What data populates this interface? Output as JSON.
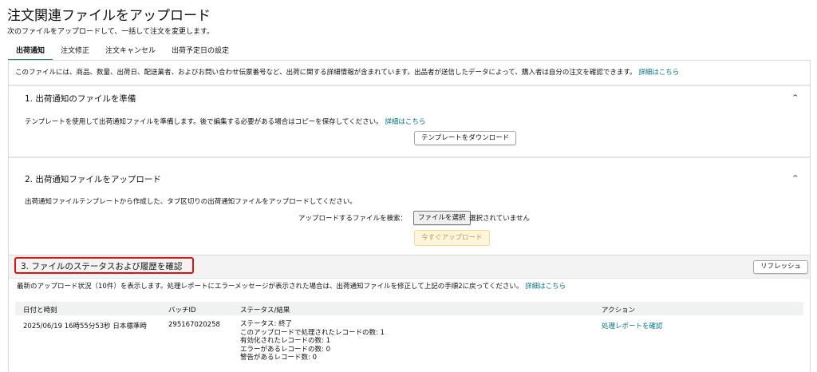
{
  "header": {
    "title": "注文関連ファイルをアップロード",
    "subtitle": "次のファイルをアップロードして、一括して注文を変更します。"
  },
  "tabs": [
    {
      "label": "出荷通知",
      "active": true
    },
    {
      "label": "注文修正",
      "active": false
    },
    {
      "label": "注文キャンセル",
      "active": false
    },
    {
      "label": "出荷予定日の設定",
      "active": false
    }
  ],
  "intro": {
    "text": "このファイルには、商品、数量、出荷日、配送業者、およびお問い合わせ伝票番号など、出荷に関する詳細情報が含まれています。出品者が送信したデータによって、購入者は自分の注文を確認できます。",
    "link": "詳細はこちら"
  },
  "section1": {
    "title": "1. 出荷通知のファイルを準備",
    "text": "テンプレートを使用して出荷通知ファイルを準備します。後で編集する必要がある場合はコピーを保存してください。",
    "link": "詳細はこちら",
    "button": "テンプレートをダウンロード"
  },
  "section2": {
    "title": "2. 出荷通知ファイルをアップロード",
    "text": "出荷通知ファイルテンプレートから作成した、タブ区切りの出荷通知ファイルをアップロードしてください。",
    "file_label": "アップロードするファイルを検索：",
    "file_button": "ファイルを選択",
    "file_status": "選択されていません",
    "upload_button": "今すぐアップロード"
  },
  "section3": {
    "title": "3. ファイルのステータスおよび履歴を確認",
    "refresh_button": "リフレッシュ",
    "text": "最新のアップロード状況（10件）を表示します。処理レポートにエラーメッセージが表示された場合は、出荷通知ファイルを修正して上記の手順2に戻ってください。",
    "link": "詳細はこちら"
  },
  "table": {
    "headers": [
      "日付と時刻",
      "バッチID",
      "ステータス/結果",
      "アクション"
    ],
    "rows": [
      {
        "datetime": "2025/06/19 16時55分53秒 日本標準時",
        "batch_id": "295167020258",
        "status": [
          "ステータス: 終了",
          "このアップロードで処理されたレコードの数: 1",
          "有効化されたレコードの数: 1",
          "エラーがあるレコードの数: 0",
          "警告があるレコード数: 0"
        ],
        "action": "処理レポートを確認"
      }
    ]
  },
  "colors": {
    "link": "#007185",
    "tab_underline": "#2c7d8e",
    "highlight_border": "#e0120e",
    "upload_disabled_bg": "#fef6dc"
  }
}
